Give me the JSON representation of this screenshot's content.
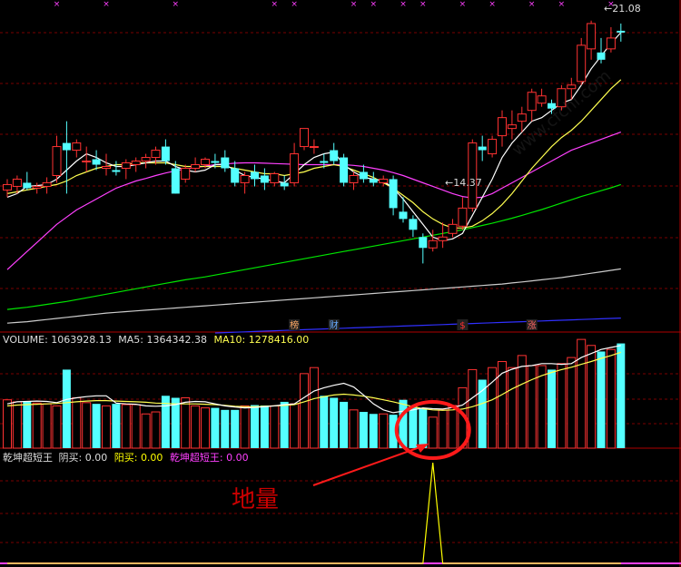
{
  "chart_data": [
    {
      "type": "candlestick",
      "ylim": [
        12.5,
        21.5
      ],
      "price_high_label": "21.08",
      "price_low_label": "14.37",
      "ohlc": [
        [
          16.4,
          16.7,
          16.2,
          16.55
        ],
        [
          16.5,
          16.8,
          16.3,
          16.7
        ],
        [
          16.6,
          16.9,
          16.4,
          16.45
        ],
        [
          16.45,
          16.6,
          16.3,
          16.5
        ],
        [
          16.5,
          16.75,
          16.3,
          16.6
        ],
        [
          16.8,
          17.9,
          16.6,
          17.6
        ],
        [
          17.7,
          18.3,
          16.3,
          17.5
        ],
        [
          17.5,
          17.8,
          17.3,
          17.7
        ],
        [
          17.2,
          17.6,
          16.9,
          17.2
        ],
        [
          17.25,
          17.5,
          16.95,
          17.1
        ],
        [
          17.0,
          17.4,
          16.8,
          17.05
        ],
        [
          16.95,
          17.2,
          16.8,
          16.9
        ],
        [
          17.0,
          17.25,
          16.7,
          17.15
        ],
        [
          17.1,
          17.3,
          16.9,
          17.2
        ],
        [
          17.2,
          17.4,
          17.0,
          17.3
        ],
        [
          17.3,
          17.6,
          17.1,
          17.5
        ],
        [
          17.6,
          17.8,
          17.1,
          17.2
        ],
        [
          17.0,
          17.2,
          16.3,
          16.3
        ],
        [
          16.7,
          17.1,
          16.6,
          17.0
        ],
        [
          17.0,
          17.3,
          16.9,
          17.1
        ],
        [
          17.1,
          17.3,
          17.0,
          17.25
        ],
        [
          17.2,
          17.4,
          17.0,
          17.15
        ],
        [
          17.3,
          17.5,
          16.9,
          17.0
        ],
        [
          17.0,
          17.2,
          16.5,
          16.6
        ],
        [
          16.6,
          16.9,
          16.3,
          16.8
        ],
        [
          16.9,
          17.1,
          16.5,
          16.7
        ],
        [
          16.8,
          17.0,
          16.4,
          16.6
        ],
        [
          16.6,
          16.9,
          16.5,
          16.85
        ],
        [
          16.6,
          16.8,
          16.4,
          16.5
        ],
        [
          16.6,
          17.7,
          16.5,
          17.4
        ],
        [
          17.6,
          18.1,
          17.5,
          18.1
        ],
        [
          17.6,
          17.8,
          17.4,
          17.6
        ],
        [
          17.2,
          17.4,
          17.0,
          17.15
        ],
        [
          17.5,
          17.7,
          17.1,
          17.2
        ],
        [
          17.3,
          17.4,
          16.5,
          16.6
        ],
        [
          16.6,
          16.9,
          16.4,
          16.8
        ],
        [
          16.9,
          17.1,
          16.6,
          16.7
        ],
        [
          16.7,
          16.9,
          16.5,
          16.6
        ],
        [
          16.6,
          16.8,
          16.5,
          16.7
        ],
        [
          16.7,
          16.8,
          15.7,
          15.9
        ],
        [
          15.8,
          16.2,
          15.5,
          15.6
        ],
        [
          15.6,
          15.7,
          15.1,
          15.3
        ],
        [
          15.1,
          15.2,
          14.37,
          14.8
        ],
        [
          14.8,
          15.3,
          14.7,
          15.0
        ],
        [
          15.0,
          15.5,
          14.8,
          15.1
        ],
        [
          15.2,
          15.6,
          15.1,
          15.45
        ],
        [
          15.4,
          16.2,
          15.3,
          15.9
        ],
        [
          15.9,
          17.8,
          15.8,
          17.7
        ],
        [
          17.6,
          17.9,
          17.2,
          17.5
        ],
        [
          17.4,
          17.9,
          17.3,
          17.8
        ],
        [
          17.9,
          18.6,
          17.6,
          18.4
        ],
        [
          18.1,
          18.6,
          17.8,
          18.2
        ],
        [
          18.3,
          18.7,
          18.0,
          18.5
        ],
        [
          18.6,
          19.2,
          18.3,
          19.1
        ],
        [
          18.8,
          19.2,
          18.7,
          19.0
        ],
        [
          18.8,
          18.9,
          18.5,
          18.65
        ],
        [
          18.7,
          19.3,
          18.6,
          19.2
        ],
        [
          19.2,
          19.5,
          18.9,
          19.3
        ],
        [
          19.4,
          20.6,
          19.3,
          20.4
        ],
        [
          20.3,
          21.08,
          20.0,
          21.0
        ],
        [
          20.2,
          20.6,
          19.9,
          20.0
        ],
        [
          20.3,
          20.9,
          20.2,
          20.6
        ],
        [
          20.8,
          21.0,
          20.5,
          20.75
        ]
      ],
      "ma5": [
        16.2,
        16.3,
        16.5,
        16.52,
        16.55,
        16.7,
        16.95,
        17.2,
        17.4,
        17.3,
        17.15,
        17.05,
        17.05,
        17.1,
        17.15,
        17.2,
        17.2,
        17.05,
        16.95,
        16.9,
        16.95,
        17.1,
        17.1,
        16.95,
        16.8,
        16.75,
        16.7,
        16.65,
        16.6,
        16.85,
        17.1,
        17.3,
        17.4,
        17.45,
        17.1,
        16.9,
        16.75,
        16.7,
        16.65,
        16.45,
        16.15,
        15.8,
        15.45,
        15.1,
        15.0,
        15.05,
        15.2,
        15.7,
        16.2,
        16.7,
        17.3,
        17.7,
        18.0,
        18.3,
        18.4,
        18.6,
        18.8,
        18.9,
        19.3,
        19.75,
        20.1,
        20.45,
        20.75
      ],
      "ma10": [
        16.3,
        16.35,
        16.4,
        16.45,
        16.5,
        16.55,
        16.65,
        16.8,
        16.9,
        17.0,
        17.05,
        17.1,
        17.1,
        17.15,
        17.15,
        17.15,
        17.15,
        17.1,
        17.05,
        17.05,
        17.05,
        17.05,
        17.05,
        17.0,
        16.95,
        16.9,
        16.85,
        16.85,
        16.8,
        16.85,
        16.9,
        17.0,
        17.05,
        17.1,
        17.05,
        16.95,
        16.85,
        16.75,
        16.6,
        16.45,
        16.25,
        16.05,
        15.8,
        15.6,
        15.45,
        15.35,
        15.35,
        15.4,
        15.55,
        15.75,
        16.0,
        16.3,
        16.65,
        17.0,
        17.3,
        17.6,
        17.85,
        18.05,
        18.3,
        18.6,
        18.9,
        19.2,
        19.45
      ],
      "ma20": [
        14.2,
        14.45,
        14.7,
        14.95,
        15.2,
        15.45,
        15.65,
        15.85,
        16.0,
        16.15,
        16.3,
        16.45,
        16.55,
        16.65,
        16.72,
        16.8,
        16.87,
        16.93,
        16.98,
        17.02,
        17.06,
        17.1,
        17.12,
        17.14,
        17.15,
        17.15,
        17.14,
        17.13,
        17.12,
        17.11,
        17.1,
        17.1,
        17.1,
        17.1,
        17.1,
        17.08,
        17.05,
        17.0,
        16.95,
        16.88,
        16.8,
        16.7,
        16.6,
        16.5,
        16.4,
        16.3,
        16.22,
        16.18,
        16.2,
        16.3,
        16.45,
        16.6,
        16.75,
        16.9,
        17.05,
        17.2,
        17.35,
        17.5,
        17.6,
        17.7,
        17.8,
        17.9,
        18.0
      ],
      "ma60": [
        13.1,
        13.13,
        13.16,
        13.2,
        13.24,
        13.28,
        13.32,
        13.37,
        13.42,
        13.47,
        13.52,
        13.57,
        13.62,
        13.67,
        13.72,
        13.77,
        13.82,
        13.87,
        13.92,
        13.96,
        14.0,
        14.05,
        14.1,
        14.15,
        14.2,
        14.25,
        14.3,
        14.35,
        14.4,
        14.45,
        14.5,
        14.55,
        14.6,
        14.65,
        14.7,
        14.75,
        14.8,
        14.85,
        14.9,
        14.95,
        15.0,
        15.05,
        15.1,
        15.15,
        15.2,
        15.25,
        15.3,
        15.36,
        15.42,
        15.48,
        15.55,
        15.62,
        15.7,
        15.78,
        15.86,
        15.95,
        16.04,
        16.13,
        16.22,
        16.3,
        16.38,
        16.46,
        16.55
      ],
      "ma120": [
        12.72,
        12.74,
        12.76,
        12.79,
        12.82,
        12.85,
        12.88,
        12.91,
        12.94,
        12.97,
        13.0,
        13.02,
        13.04,
        13.06,
        13.08,
        13.1,
        13.12,
        13.14,
        13.16,
        13.18,
        13.2,
        13.22,
        13.24,
        13.26,
        13.28,
        13.3,
        13.32,
        13.34,
        13.36,
        13.38,
        13.4,
        13.42,
        13.44,
        13.46,
        13.48,
        13.5,
        13.52,
        13.54,
        13.56,
        13.58,
        13.6,
        13.62,
        13.64,
        13.66,
        13.68,
        13.7,
        13.72,
        13.74,
        13.76,
        13.78,
        13.8,
        13.83,
        13.86,
        13.89,
        13.92,
        13.95,
        13.98,
        14.02,
        14.06,
        14.1,
        14.14,
        14.18,
        14.22
      ],
      "ma250_start_index": 21,
      "ma250": [
        12.45,
        12.46,
        12.47,
        12.48,
        12.49,
        12.5,
        12.51,
        12.52,
        12.53,
        12.54,
        12.55,
        12.56,
        12.57,
        12.58,
        12.59,
        12.6,
        12.61,
        12.62,
        12.63,
        12.64,
        12.65,
        12.66,
        12.67,
        12.68,
        12.69,
        12.7,
        12.71,
        12.72,
        12.73,
        12.74,
        12.75,
        12.76,
        12.77,
        12.78,
        12.79,
        12.8,
        12.81,
        12.82,
        12.83,
        12.84,
        12.85,
        12.86
      ],
      "colors": {
        "up": "#ff3232",
        "down": "#54ffff",
        "ma5": "#ffffff",
        "ma10": "#ffff50",
        "ma20": "#ff40ff",
        "ma60": "#00e600",
        "ma120": "#cccccc",
        "ma250": "#3030ff"
      },
      "markers_top_index": [
        5,
        10,
        17,
        27,
        29,
        35,
        37,
        40,
        42,
        46,
        49,
        53,
        56,
        61
      ],
      "event_tags": [
        {
          "index": 29,
          "text": "榜",
          "color": "#ffaa66"
        },
        {
          "index": 33,
          "text": "财",
          "color": "#66aaff"
        },
        {
          "index": 46,
          "text": "$",
          "color": "#ff3333"
        },
        {
          "index": 53,
          "text": "涨",
          "color": "#ff6666"
        }
      ]
    },
    {
      "type": "bar",
      "name": "volume",
      "header": {
        "volume_label": "VOLUME:",
        "volume_value": "1063928.13",
        "ma5_label": "MA5:",
        "ma5_value": "1364342.38",
        "ma10_label": "MA10:",
        "ma10_value": "1278416.00"
      },
      "ylim": [
        0,
        2500000
      ],
      "values": [
        1200000,
        1150000,
        1150000,
        1120000,
        1100000,
        1050000,
        1950000,
        1250000,
        1130000,
        1100000,
        1050000,
        1100000,
        1080000,
        1080000,
        850000,
        900000,
        1300000,
        1250000,
        1250000,
        1050000,
        1000000,
        1000000,
        950000,
        950000,
        1050000,
        1070000,
        1060000,
        1050000,
        1150000,
        1100000,
        1850000,
        2000000,
        1300000,
        1250000,
        1150000,
        950000,
        900000,
        850000,
        850000,
        830000,
        1200000,
        1050000,
        980000,
        770000,
        950000,
        1060000,
        1500000,
        1950000,
        1700000,
        2000000,
        2150000,
        2000000,
        2300000,
        2050000,
        2050000,
        1950000,
        2100000,
        2250000,
        2700000,
        2550000,
        2400000,
        2450000,
        2600000
      ],
      "ma5": [
        1100000,
        1150000,
        1160000,
        1170000,
        1160000,
        1130000,
        1210000,
        1250000,
        1280000,
        1300000,
        1300000,
        1120000,
        1100000,
        1090000,
        1050000,
        1040000,
        1050000,
        1080000,
        1140000,
        1160000,
        1150000,
        1100000,
        1050000,
        1020000,
        1000000,
        1010000,
        1030000,
        1050000,
        1080000,
        1100000,
        1260000,
        1420000,
        1500000,
        1560000,
        1610000,
        1520000,
        1320000,
        1100000,
        950000,
        880000,
        920000,
        950000,
        1000000,
        980000,
        970000,
        1010000,
        1070000,
        1250000,
        1430000,
        1640000,
        1860000,
        1960000,
        2030000,
        2050000,
        2100000,
        2100000,
        2080000,
        2100000,
        2250000,
        2350000,
        2450000,
        2500000,
        2550000
      ],
      "ma10": [
        1050000,
        1070000,
        1080000,
        1090000,
        1100000,
        1110000,
        1130000,
        1150000,
        1170000,
        1180000,
        1180000,
        1170000,
        1160000,
        1150000,
        1140000,
        1120000,
        1110000,
        1100000,
        1100000,
        1100000,
        1090000,
        1080000,
        1060000,
        1040000,
        1030000,
        1030000,
        1040000,
        1050000,
        1060000,
        1080000,
        1150000,
        1230000,
        1280000,
        1320000,
        1340000,
        1320000,
        1290000,
        1250000,
        1200000,
        1150000,
        1090000,
        1030000,
        980000,
        950000,
        940000,
        950000,
        970000,
        1030000,
        1110000,
        1200000,
        1330000,
        1470000,
        1590000,
        1700000,
        1800000,
        1880000,
        1950000,
        2010000,
        2080000,
        2150000,
        2230000,
        2300000,
        2380000
      ],
      "colors": {
        "ma5": "#ffffff",
        "ma10": "#ffff50"
      }
    },
    {
      "type": "line",
      "name": "indicator",
      "header": {
        "name": "乾坤超短王",
        "yinbuy_label": "阴买:",
        "yinbuy_value": "0.00",
        "yangbuy_label": "阳买:",
        "yangbuy_value": "0.00",
        "name2_label": "乾坤超短王:",
        "name2_value": "0.00"
      },
      "ylim": [
        0,
        1
      ],
      "yinbuy": [
        0,
        0,
        0,
        0,
        0,
        0,
        0,
        0,
        0,
        0,
        0,
        0,
        0,
        0,
        0,
        0,
        0,
        0,
        0,
        0,
        0,
        0,
        0,
        0,
        0,
        0,
        0,
        0,
        0,
        0,
        0,
        0,
        0,
        0,
        0,
        0,
        0,
        0,
        0,
        0,
        0,
        0,
        0,
        1,
        0,
        0,
        0,
        0,
        0,
        0,
        0,
        0,
        0,
        0,
        0,
        0,
        0,
        0,
        0,
        0,
        0,
        0,
        0
      ],
      "colors": {
        "yinbuy": "#ffff00",
        "baseline": "#ff40ff"
      }
    }
  ],
  "annotation": {
    "text": "地量",
    "color": "#cc0000"
  },
  "watermark": "www.cfchi.com"
}
